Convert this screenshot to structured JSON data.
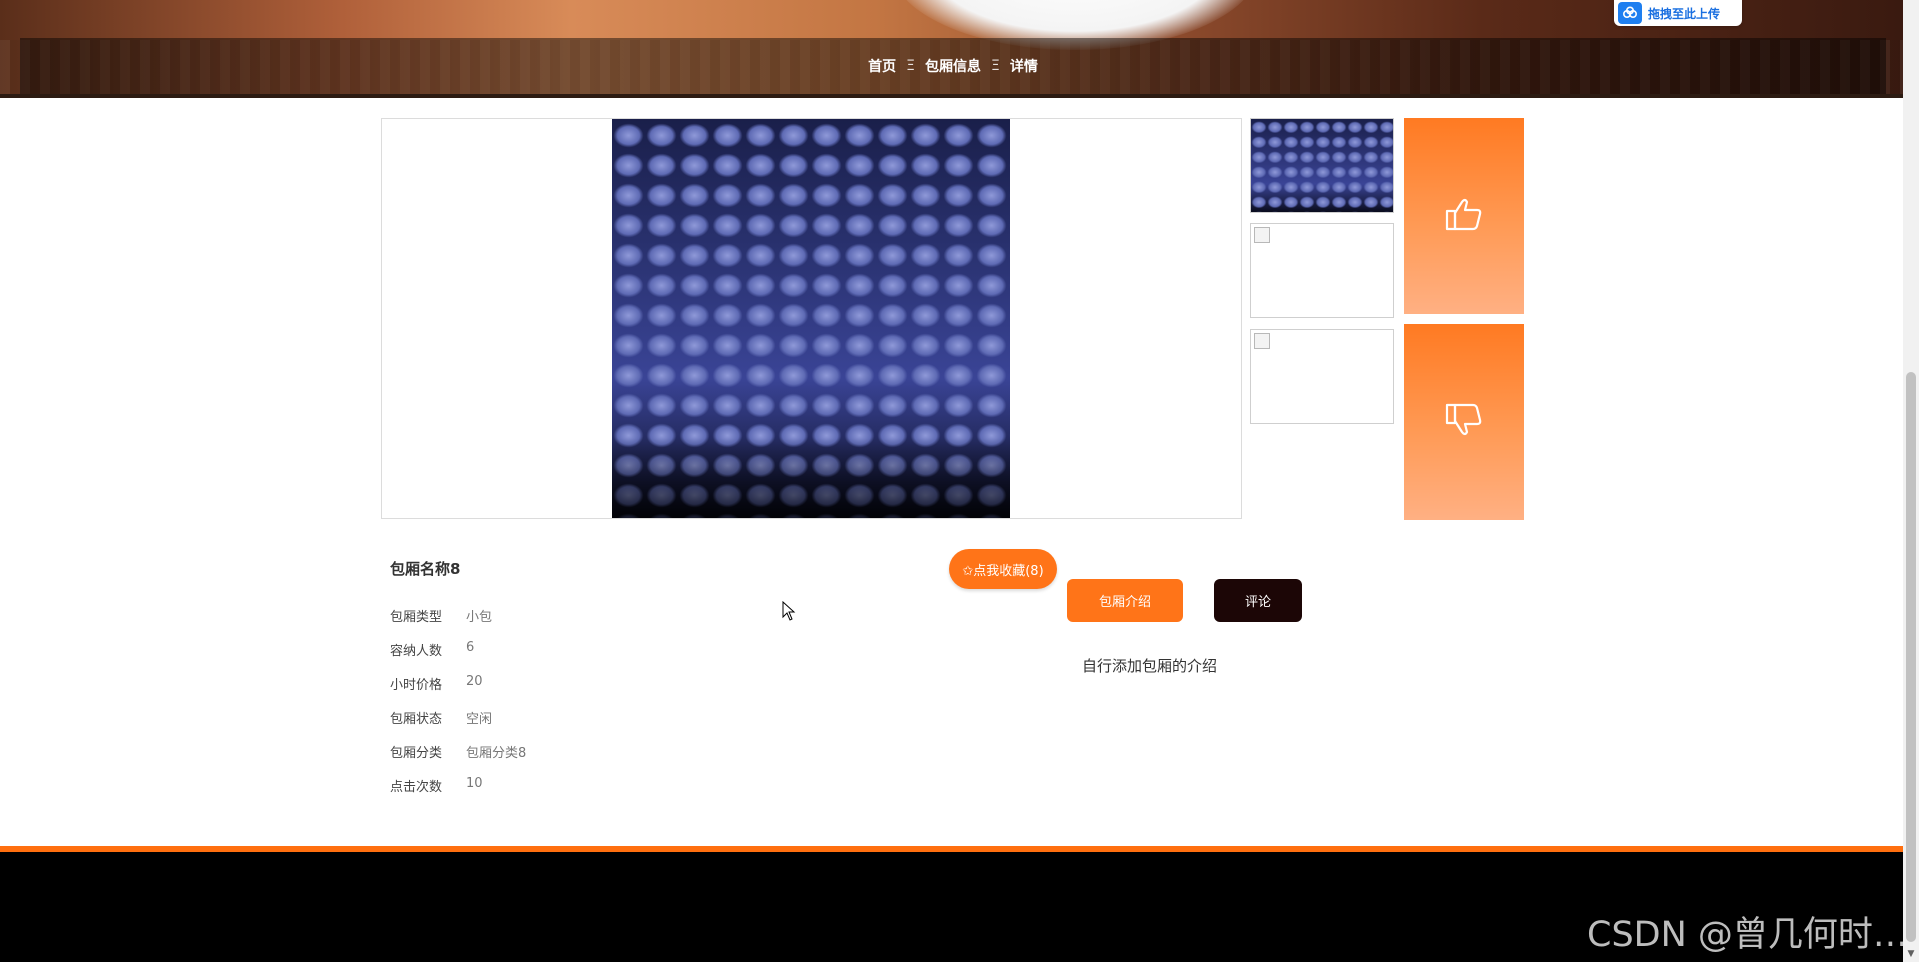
{
  "header": {
    "breadcrumb": [
      {
        "label": "首页"
      },
      {
        "label": "包厢信息"
      },
      {
        "label": "详情"
      }
    ],
    "separator": "Ξ",
    "upload_label": "拖拽至此上传"
  },
  "room": {
    "title": "包厢名称8",
    "fields": [
      {
        "key": "包厢类型",
        "value": "小包"
      },
      {
        "key": "容纳人数",
        "value": "6"
      },
      {
        "key": "小时价格",
        "value": "20"
      },
      {
        "key": "包厢状态",
        "value": "空闲"
      },
      {
        "key": "包厢分类",
        "value": "包厢分类8"
      },
      {
        "key": "点击次数",
        "value": "10"
      }
    ]
  },
  "actions": {
    "favorite_label": "✩点我收藏(8)",
    "intro_tab_label": "包厢介绍",
    "comment_tab_label": "评论"
  },
  "intro": {
    "text": "自行添加包厢的介绍"
  },
  "watermark": "CSDN @曾几何时…",
  "colors": {
    "accent": "#ff7418",
    "dark_button": "#1c0606",
    "footer": "#000000"
  }
}
